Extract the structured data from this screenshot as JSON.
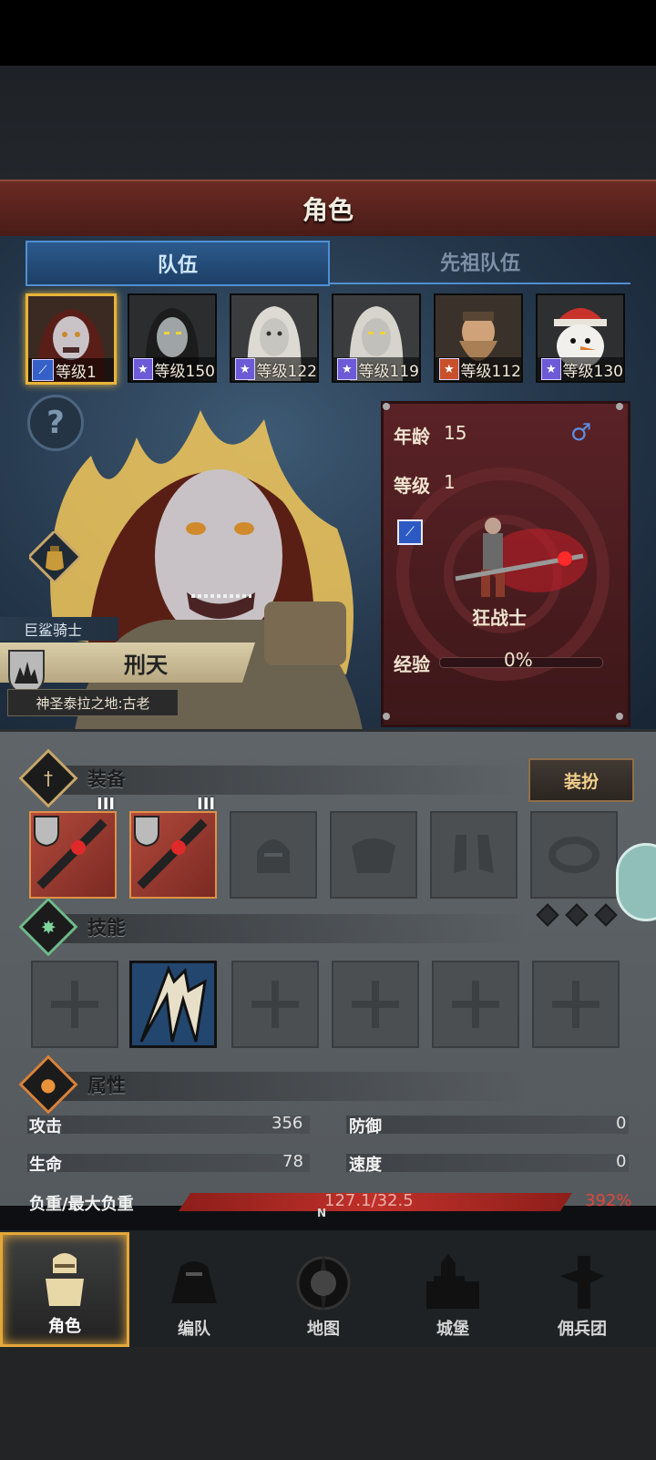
{
  "header": {
    "title": "角色"
  },
  "tabs": [
    {
      "label": "队伍"
    },
    {
      "label": "先祖队伍"
    }
  ],
  "team": [
    {
      "level_label": "等级1",
      "selected": true
    },
    {
      "level_label": "等级150"
    },
    {
      "level_label": "等级122"
    },
    {
      "level_label": "等级119"
    },
    {
      "level_label": "等级112"
    },
    {
      "level_label": "等级130"
    }
  ],
  "hero": {
    "class_label": "巨鲨骑士",
    "name": "刑天",
    "origin": "神圣泰拉之地:古老"
  },
  "card": {
    "age_label": "年龄",
    "age_value": "15",
    "gender_symbol": "♂",
    "level_label": "等级",
    "level_value": "1",
    "class_name": "狂战士",
    "exp_label": "经验",
    "exp_value": "0%",
    "exp_fraction": 0
  },
  "equipment": {
    "title": "装备",
    "outfit_button": "装扮",
    "tier_labels": [
      "III",
      "III"
    ]
  },
  "skills": {
    "title": "技能"
  },
  "attributes": {
    "title": "属性",
    "attack_label": "攻击",
    "attack_value": "356",
    "defense_label": "防御",
    "defense_value": "0",
    "hp_label": "生命",
    "hp_value": "78",
    "speed_label": "速度",
    "speed_value": "0",
    "load_label": "负重/最大负重",
    "load_value": "127.1/32.5",
    "load_percent": "392%"
  },
  "nav": [
    {
      "label": "角色"
    },
    {
      "label": "编队"
    },
    {
      "label": "地图",
      "compass": "N"
    },
    {
      "label": "城堡"
    },
    {
      "label": "佣兵团"
    }
  ],
  "colors": {
    "accent_gold": "#e7b43a",
    "tab_blue": "#4f8fd2",
    "card_red": "#5a2226",
    "load_red": "#c0302a"
  }
}
